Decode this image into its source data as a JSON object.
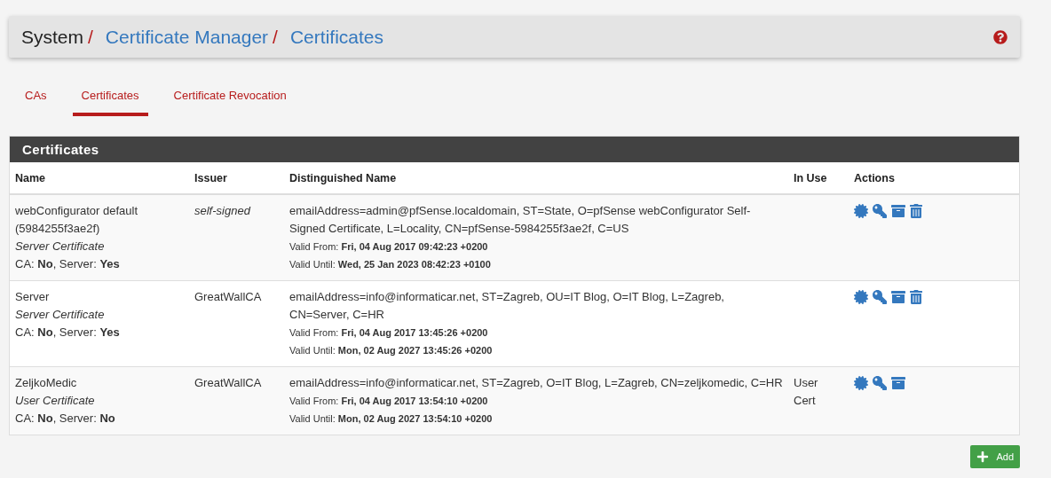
{
  "breadcrumb": [
    {
      "label": "System",
      "link": false,
      "separator": "/"
    },
    {
      "label": "Certificate Manager",
      "link": true,
      "separator": "/"
    },
    {
      "label": "Certificates",
      "link": true
    }
  ],
  "tabs": [
    {
      "label": "CAs",
      "selected": false
    },
    {
      "label": "Certificates",
      "selected": true
    },
    {
      "label": "Certificate Revocation",
      "selected": false
    }
  ],
  "panel": {
    "title": "Certificates",
    "table": {
      "columns": [
        "Name",
        "Issuer",
        "Distinguished Name",
        "In Use",
        "Actions"
      ],
      "rows": [
        {
          "name": [
            "webConfigurator default",
            "(5984255f3ae2f)"
          ],
          "type": "Server Certificate",
          "flags": "CA: **No**, Server: **Yes**",
          "issuer": "self-signed",
          "issuer_italic": true,
          "dn": "emailAddress=admin@pfSense.localdomain, ST=State, O=pfSense webConfigurator Self-Signed Certificate, L=Locality, CN=pfSense-5984255f3ae2f, C=US",
          "valid_from": "Valid From: **Fri, 04 Aug 2017 09:42:23 +0200**",
          "valid_until": "Valid Until: **Wed, 25 Jan 2023 08:42:23 +0100**",
          "in_use": [],
          "actions": [
            {
              "kind": "certificate"
            },
            {
              "kind": "key"
            },
            {
              "kind": "archive"
            },
            {
              "kind": "delete"
            }
          ]
        },
        {
          "name": [
            "Server"
          ],
          "type": "Server Certificate",
          "flags": "CA: **No**, Server: **Yes**",
          "issuer": "GreatWallCA",
          "issuer_italic": false,
          "dn": "emailAddress=info@informaticar.net, ST=Zagreb, OU=IT Blog, O=IT Blog, L=Zagreb, CN=Server, C=HR",
          "valid_from": "Valid From: **Fri, 04 Aug 2017 13:45:26 +0200**",
          "valid_until": "Valid Until: **Mon, 02 Aug 2027 13:45:26 +0200**",
          "in_use": [],
          "actions": [
            {
              "kind": "certificate"
            },
            {
              "kind": "key"
            },
            {
              "kind": "archive"
            },
            {
              "kind": "delete"
            }
          ]
        },
        {
          "name": [
            "ZeljkoMedic"
          ],
          "type": "User Certificate",
          "flags": "CA: **No**, Server: **No**",
          "issuer": "GreatWallCA",
          "issuer_italic": false,
          "dn": "emailAddress=info@informaticar.net, ST=Zagreb, O=IT Blog, L=Zagreb, CN=zeljkomedic, C=HR",
          "valid_from": "Valid From: **Fri, 04 Aug 2017 13:54:10 +0200**",
          "valid_until": "Valid Until: **Mon, 02 Aug 2027 13:54:10 +0200**",
          "in_use": [
            "User",
            "Cert"
          ],
          "actions": [
            {
              "kind": "certificate"
            },
            {
              "kind": "key"
            },
            {
              "kind": "archive"
            }
          ]
        }
      ]
    }
  },
  "add_button": {
    "label": "Add"
  }
}
